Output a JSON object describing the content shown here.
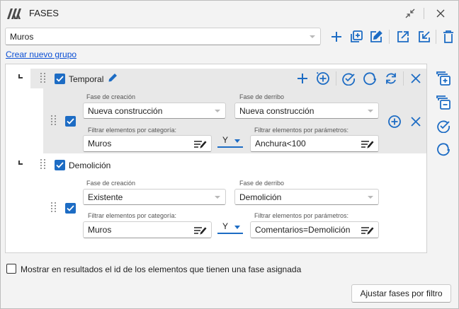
{
  "window": {
    "title": "FASES",
    "icons": {
      "logo": "app-logo-icon",
      "collapse": "collapse-arrows-icon",
      "close": "close-icon"
    }
  },
  "toolbar": {
    "group_select": {
      "value": "Muros"
    },
    "icons": [
      "add-icon",
      "add-copy-icon",
      "edit-icon",
      "export-icon",
      "import-icon",
      "delete-icon"
    ]
  },
  "create_group_link": "Crear nuevo grupo",
  "groups": [
    {
      "name": "Temporal",
      "checked": true,
      "rules": [
        {
          "checked": true,
          "fase_creacion_label": "Fase de creación",
          "fase_creacion_value": "Nueva construcción",
          "fase_derribo_label": "Fase de derribo",
          "fase_derribo_value": "Nueva construcción",
          "categoria_label": "Filtrar elementos por categoría:",
          "categoria_value": "Muros",
          "operator": "Y",
          "parametros_label": "Filtrar elementos por parámetros:",
          "parametros_value": "Anchura<100"
        }
      ]
    },
    {
      "name": "Demolición",
      "checked": true,
      "rules": [
        {
          "checked": true,
          "fase_creacion_label": "Fase de creación",
          "fase_creacion_value": "Existente",
          "fase_derribo_label": "Fase de derribo",
          "fase_derribo_value": "Demolición",
          "categoria_label": "Filtrar elementos por categoría:",
          "categoria_value": "Muros",
          "operator": "Y",
          "parametros_label": "Filtrar elementos por parámetros:",
          "parametros_value": "Comentarios=Demolición"
        }
      ]
    }
  ],
  "footer": {
    "checkbox_label": "Mostrar en resultados el id de los elementos que tienen una fase asignada",
    "checkbox_checked": false,
    "apply_button": "Ajustar fases por filtro"
  },
  "colors": {
    "accent": "#1d6cc4",
    "link": "#0b4fd4",
    "window_bg": "#f3f3f3",
    "group_row_bg": "#e8e8e8"
  }
}
